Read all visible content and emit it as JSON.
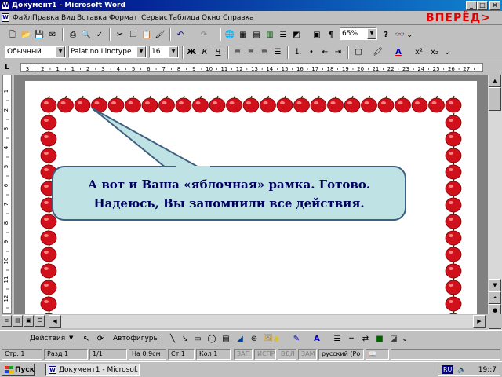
{
  "window": {
    "title": "Документ1 - Microsoft Word",
    "icon_label": "W"
  },
  "title_buttons": {
    "minimize": "_",
    "maximize": "□",
    "close": "×"
  },
  "menu": {
    "items": [
      "Файл",
      "Правка",
      "Вид",
      "Вставка",
      "Формат",
      "Сервис",
      "Таблица",
      "Окно",
      "Справка"
    ],
    "close_doc": "×"
  },
  "nav": {
    "forward_label": "ВПЕРЁД>"
  },
  "toolbar_standard": {
    "icons": [
      "new-document-icon",
      "open-folder-icon",
      "save-icon",
      "email-icon",
      "print-icon",
      "print-preview-icon",
      "spelling-icon",
      "cut-icon",
      "copy-icon",
      "paste-icon",
      "format-painter-icon",
      "undo-icon",
      "redo-icon",
      "hyperlink-icon",
      "tables-borders-icon",
      "insert-table-icon",
      "insert-excel-icon",
      "columns-icon",
      "drawing-icon",
      "document-map-icon",
      "show-formatting-icon"
    ],
    "zoom": "65%",
    "help": "?",
    "read": "🕮"
  },
  "toolbar_formatting": {
    "style": "Обычный",
    "font": "Palatino Linotype",
    "size": "16",
    "bold": "Ж",
    "italic": "К",
    "underline": "Ч",
    "font_color_label": "A"
  },
  "ruler": {
    "corner": "L",
    "numbers": [
      "3",
      "2",
      "1",
      "1",
      "2",
      "3",
      "4",
      "5",
      "6",
      "7",
      "8",
      "9",
      "10",
      "11",
      "12",
      "13",
      "14",
      "15",
      "16",
      "17",
      "18",
      "19",
      "20",
      "21",
      "22",
      "23",
      "24",
      "25",
      "26",
      "27"
    ]
  },
  "vruler_numbers": [
    "1",
    "2",
    "3",
    "4",
    "5",
    "6",
    "7",
    "8",
    "9",
    "10",
    "11",
    "12"
  ],
  "document": {
    "callout_line1": "А вот и Ваша «яблочная» рамка. Готово.",
    "callout_line2": "Надеюсь, Вы запомнили все действия.",
    "border_color": "#d0101a",
    "callout_fill": "#bfe2e4",
    "callout_text_color": "#000060"
  },
  "drawing_toolbar": {
    "actions": "Действия",
    "autoshapes": "Автофигуры"
  },
  "status": {
    "page": "Стр. 1",
    "section": "Разд 1",
    "pages": "1/1",
    "at": "На 0,9см",
    "line": "Ст 1",
    "col": "Кол 1",
    "rec": "ЗАП",
    "trk": "ИСПР",
    "ext": "ВДЛ",
    "ovr": "ЗАМ",
    "language": "русский (Ро"
  },
  "taskbar": {
    "start": "Пуск",
    "task": "Документ1 - Microsof...",
    "lang": "RU",
    "clock": "19::7"
  }
}
